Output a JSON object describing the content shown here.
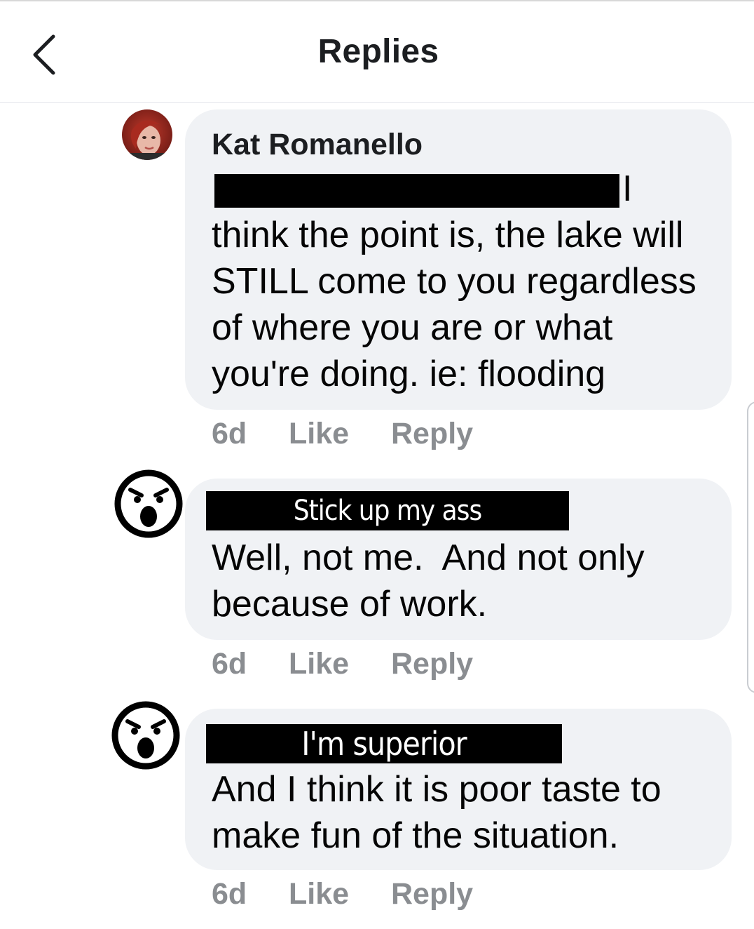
{
  "header": {
    "title": "Replies",
    "back_icon": "chevron-left-icon"
  },
  "comments": [
    {
      "author": "Kat Romanello",
      "avatar": "user-photo-avatar",
      "redacted_start": "I",
      "text": "think the point is, the lake will\nSTILL come to you regardless\nof where you are or what\nyou're doing. ie: flooding",
      "time": "6d",
      "like_label": "Like",
      "reply_label": "Reply"
    },
    {
      "author_label": "Stick up my ass",
      "avatar": "angry-face-icon",
      "text": "Well, not me.  And not only\nbecause of work.",
      "time": "6d",
      "like_label": "Like",
      "reply_label": "Reply"
    },
    {
      "author_label": "I'm superior",
      "avatar": "angry-face-icon",
      "text": "And I think it is poor taste to\nmake fun of the situation.",
      "time": "6d",
      "like_label": "Like",
      "reply_label": "Reply"
    }
  ],
  "colors": {
    "bubble": "#f0f2f5",
    "meta_text": "#8a8d91",
    "redaction": "#000000"
  }
}
